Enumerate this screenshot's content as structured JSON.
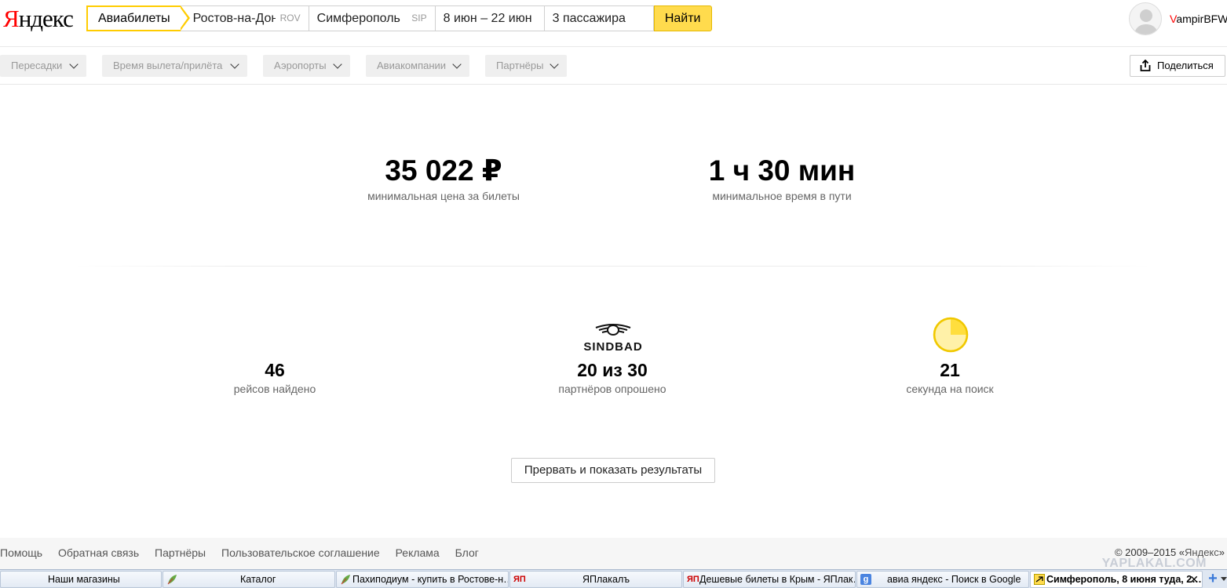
{
  "header": {
    "logo_first": "Я",
    "logo_rest": "ндекс",
    "service_tab": "Авиабилеты",
    "from_city": "Ростов-на-Дону",
    "from_code": "ROV",
    "to_city": "Симферополь",
    "to_code": "SIP",
    "dates": "8 июн – 22 июн",
    "passengers": "3 пассажира",
    "find_button": "Найти",
    "user_first": "V",
    "user_rest": "ampirBFW"
  },
  "filters": [
    {
      "label": "Пересадки"
    },
    {
      "label": "Время вылета/прилёта"
    },
    {
      "label": "Аэропорты"
    },
    {
      "label": "Авиакомпании"
    },
    {
      "label": "Партнёры"
    }
  ],
  "share_button": "Поделиться",
  "summary": {
    "min_price": "35 022 ₽",
    "min_price_label": "минимальная цена за билеты",
    "min_time": "1 ч 30 мин",
    "min_time_label": "минимальное время в пути",
    "flights_found": "46",
    "flights_found_label": "рейсов найдено",
    "partner_logo_text": "SINDBAD",
    "partners_polled": "20 из 30",
    "partners_polled_label": "партнёров опрошено",
    "seconds": "21",
    "seconds_label": "секунда на поиск",
    "timer_progress": 0.25
  },
  "interrupt_button": "Прервать и показать результаты",
  "footer": {
    "links": [
      "Помощь",
      "Обратная связь",
      "Партнёры",
      "Пользовательское соглашение",
      "Реклама",
      "Блог"
    ],
    "copyright": "© 2009–2015 «",
    "copyright_brand": "Яндекс",
    "copyright_end": "»",
    "watermark": "YAPLAKAL.COM"
  },
  "taskbar": {
    "tabs": [
      {
        "label": "Наши магазины",
        "icon": "none"
      },
      {
        "label": "Каталог",
        "icon": "leaf-icon"
      },
      {
        "label": "Пахиподиум - купить в Ростове-н…",
        "icon": "leaf-icon"
      },
      {
        "label": "ЯПлакалъ",
        "icon": "yaplakal-icon"
      },
      {
        "label": "Дешевые билеты в Крым - ЯПлак…",
        "icon": "yaplakal-icon"
      },
      {
        "label": "авиа яндекс - Поиск в Google",
        "icon": "google-icon"
      },
      {
        "label": "Симферополь, 8 июня туда, 2…",
        "icon": "plane-icon"
      }
    ]
  },
  "colors": {
    "accent_yellow": "#ffdb4d",
    "tab_border": "#ffcc00",
    "logo_red": "#ff0000",
    "timer_fill": "#fff1a8"
  }
}
